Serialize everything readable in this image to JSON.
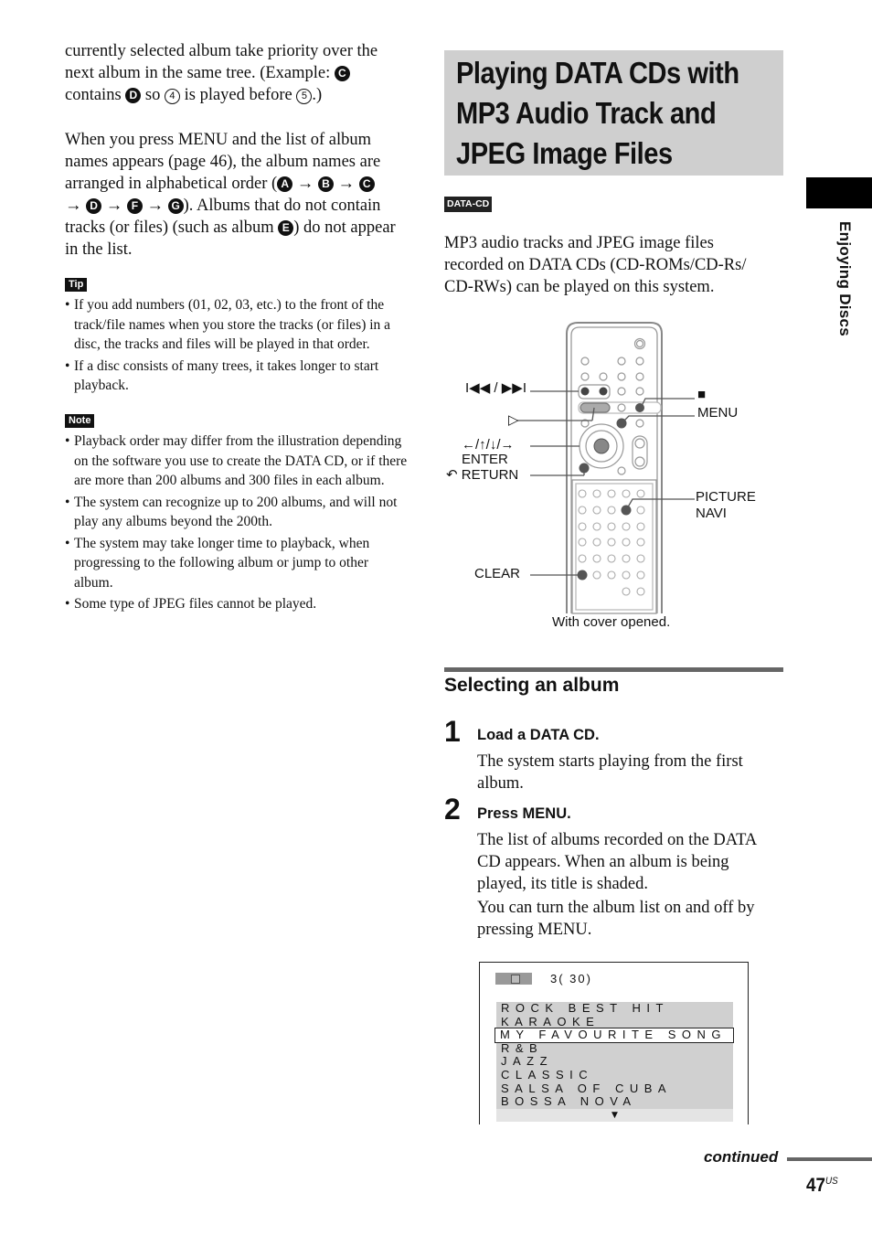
{
  "left_column": {
    "para1": {
      "line1": "currently selected album take priority over the",
      "line2a": "next album in the same tree. (Example: ",
      "circle_c": "C",
      "line3a": "contains ",
      "circle_d": "D",
      "line3b": " so ",
      "num4": "4",
      "line3c": " is played before ",
      "num5": "5",
      "line3d": ".)"
    },
    "para2": {
      "line1": "When you press MENU and the list of album",
      "line2": "names appears (page 46), the album names are",
      "line3a": "arranged in alphabetical order (",
      "order": [
        "A",
        "B",
        "C",
        "D",
        "F",
        "G"
      ],
      "arrow": "→",
      "line4b": "). Albums that do not contain",
      "line5a": "tracks (or files) (such as album ",
      "circle_e": "E",
      "line5b": ") do not appear",
      "line6": "in the list."
    },
    "tip": {
      "label": "Tip",
      "items": [
        "If you add numbers (01, 02, 03, etc.) to the front of the track/file names when you store the tracks (or files) in a disc, the tracks and files will be played in that order.",
        "If a disc consists of many trees, it takes longer to start playback."
      ]
    },
    "note": {
      "label": "Note",
      "items": [
        "Playback order may differ from the illustration depending on the software you use to create the DATA CD, or if there are more than 200 albums and 300 files in each album.",
        " The system can recognize up to 200 albums, and will not play any albums beyond the 200th.",
        "The system may take longer time to playback, when progressing to the following album or jump to other album.",
        "Some type of JPEG files cannot be played."
      ]
    }
  },
  "right_column": {
    "title_lines": [
      "Playing DATA CDs with",
      "MP3 Audio Track and",
      "JPEG Image Files"
    ],
    "data_cd_badge": "DATA-CD",
    "intro": [
      "MP3 audio tracks and JPEG image files",
      "recorded on DATA CDs (CD-ROMs/CD-Rs/",
      "CD-RWs) can be played on this system."
    ],
    "remote": {
      "labels": {
        "prev_next": "I◀◀ / ▶▶I",
        "play": "▷",
        "arrows": "←/↑/↓/→",
        "enter": "ENTER",
        "return_icon": "↶",
        "return": "RETURN",
        "stop": "■",
        "menu": "MENU",
        "picture": "PICTURE",
        "navi": "NAVI",
        "clear": "CLEAR"
      },
      "caption": "With cover opened."
    },
    "section_heading": "Selecting an album",
    "steps": [
      {
        "num": "1",
        "title": "Load a DATA CD.",
        "body": [
          "The system starts playing from the first album."
        ]
      },
      {
        "num": "2",
        "title": "Press MENU.",
        "body": [
          "The list of albums recorded on the DATA CD appears. When an album is being played, its title is shaded.",
          "You can turn the album list on and off by pressing MENU."
        ]
      }
    ],
    "screen": {
      "counter": "3( 30)",
      "albums": [
        "ROCK BEST HIT",
        "KARAOKE",
        "MY FAVOURITE SONG",
        "R&B",
        "JAZZ",
        "CLASSIC",
        "SALSA OF CUBA",
        "BOSSA NOVA"
      ],
      "selected_index": 2,
      "more_indicator": "▼"
    }
  },
  "side_tab": {
    "label": "Enjoying Discs"
  },
  "footer": {
    "continued": "continued",
    "page_number": "47",
    "page_suffix": "US"
  }
}
